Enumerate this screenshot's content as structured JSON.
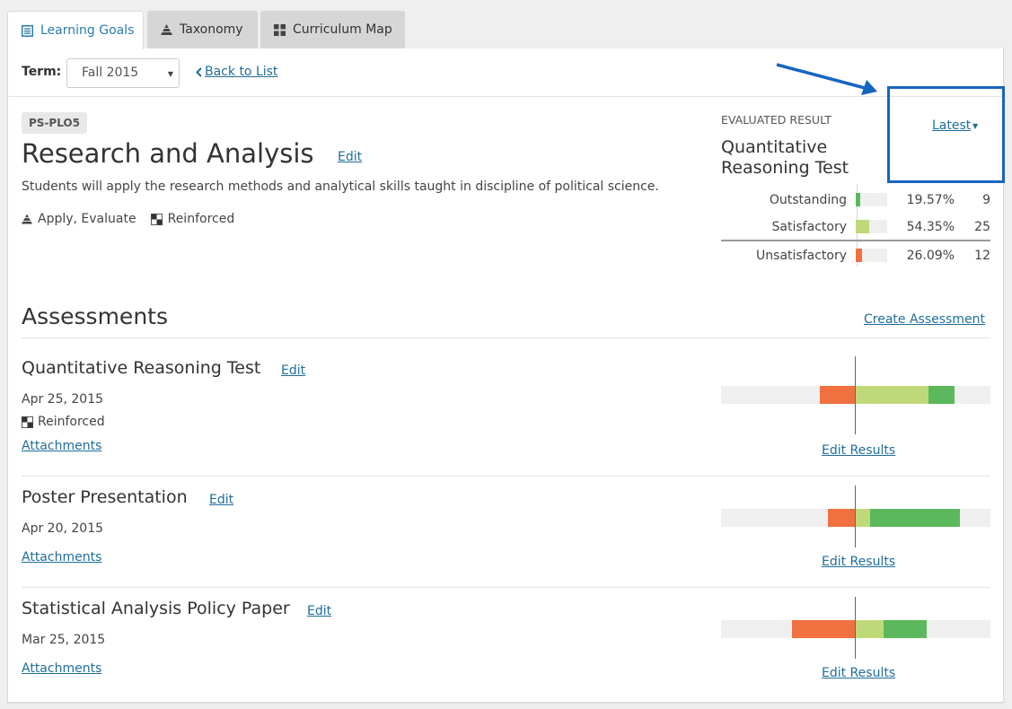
{
  "tabs": [
    {
      "label": "Learning Goals",
      "icon": "list-icon"
    },
    {
      "label": "Taxonomy",
      "icon": "pyramid-icon"
    },
    {
      "label": "Curriculum Map",
      "icon": "grid-icon"
    }
  ],
  "term": {
    "label": "Term:",
    "selected": "Fall 2015"
  },
  "back_link": "Back to List",
  "goal": {
    "code": "PS-PLO5",
    "title": "Research and Analysis",
    "edit": "Edit",
    "description": "Students will apply the research methods and analytical skills taught in discipline of political science.",
    "levels": "Apply, Evaluate",
    "coverage": "Reinforced"
  },
  "evaluated": {
    "label": "EVALUATED RESULT",
    "title": "Quantitative Reasoning Test",
    "latest": "Latest",
    "rows": [
      {
        "label": "Outstanding",
        "percent": "19.57%",
        "count": "9",
        "fraction": 0.1957,
        "color": "#5cb85c"
      },
      {
        "label": "Satisfactory",
        "percent": "54.35%",
        "count": "25",
        "fraction": 0.5435,
        "color": "#bfd97a"
      },
      {
        "label": "Unsatisfactory",
        "percent": "26.09%",
        "count": "12",
        "fraction": 0.2609,
        "color": "#f0703f"
      }
    ]
  },
  "assessments": {
    "heading": "Assessments",
    "create": "Create Assessment",
    "edit_label": "Edit",
    "attachments_label": "Attachments",
    "results_label": "Edit Results",
    "items": [
      {
        "title": "Quantitative Reasoning Test",
        "date": "Apr 25, 2015",
        "coverage": "Reinforced",
        "unsatisfactory": 0.2609,
        "satisfactory": 0.5435,
        "outstanding": 0.1957
      },
      {
        "title": "Poster Presentation",
        "date": "Apr 20, 2015",
        "coverage": "",
        "unsatisfactory": 0.2,
        "satisfactory": 0.11,
        "outstanding": 0.67
      },
      {
        "title": "Statistical Analysis Policy Paper",
        "date": "Mar 25, 2015",
        "coverage": "",
        "unsatisfactory": 0.47,
        "satisfactory": 0.21,
        "outstanding": 0.32
      }
    ]
  },
  "colors": {
    "unsatisfactory": "#f0703f",
    "satisfactory": "#bfd97a",
    "outstanding": "#5cb85c",
    "link": "#1f6d9c",
    "highlight": "#1565c0"
  }
}
